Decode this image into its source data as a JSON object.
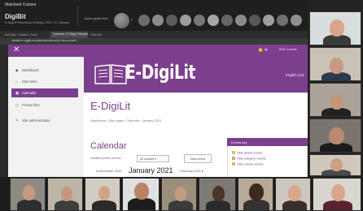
{
  "meeting": {
    "title": "Mainland Cuisine",
    "logo": "DigiBit",
    "subtitle": "E-DigiLit Partnership Meeting • 2021 • 27 January",
    "quick_action": "Quick guide here"
  },
  "browser": {
    "tab_label": "Self-Sign • ClassIn • Zoom",
    "active_tab": "Calendar • E-DigiLit Moodle",
    "other_tab": "New Tab",
    "address": "moodle.e-digilit.eu/calendar/view.php?view=month"
  },
  "moodle": {
    "user": "Elnir Cuevas",
    "sidebar": [
      {
        "icon": "dashboard-icon",
        "glyph": "◆",
        "label": "Dashboard"
      },
      {
        "icon": "home-icon",
        "glyph": "⌂",
        "label": "Site home"
      },
      {
        "icon": "calendar-icon",
        "glyph": "▦",
        "label": "Calendar"
      },
      {
        "icon": "file-icon",
        "glyph": "▢",
        "label": "Private files"
      },
      {
        "icon": "wrench-icon",
        "glyph": "✎",
        "label": "Site administration"
      }
    ],
    "brand": "E-DigiLit",
    "language": "English (en)",
    "page_title": "E-DigiLit",
    "breadcrumb": "Dashboard › Site pages › Calendar › January 2021",
    "calendar_heading": "Calendar",
    "detail_label": "Detailed month view for:",
    "course_select": "All courses ▾",
    "new_event_button": "New event",
    "prev_month": "◂ December 2020",
    "current_month": "January 2021",
    "next_month": "February 2021 ▸",
    "events_key": {
      "title": "Events key",
      "items": [
        {
          "label": "Hide global events",
          "color": "#b5d06a"
        },
        {
          "label": "Hide category events",
          "color": "#d99aa0"
        },
        {
          "label": "Hide course events",
          "color": "#e6b46a"
        }
      ]
    }
  },
  "colors": {
    "accent": "#7b3f8e"
  }
}
